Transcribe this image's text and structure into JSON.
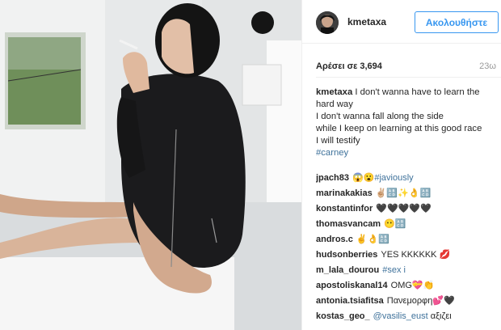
{
  "post": {
    "username": "kmetaxa",
    "follow_label": "Ακολουθήστε",
    "likes": "Αρέσει σε 3,694",
    "time": "23ω",
    "caption_lines": [
      "I don't wanna have to learn the hard way",
      "I don't wanna fall along the side",
      "while I keep on learning at this good race",
      "I will testify"
    ],
    "caption_tag": "#carney"
  },
  "comments": [
    {
      "user": "jpach83",
      "text": "😱😮",
      "tag": "#javiously"
    },
    {
      "user": "marinakakias",
      "text": "✌🏼🔠✨👌🔠",
      "tag": ""
    },
    {
      "user": "konstantinfor",
      "text": "🖤🖤🖤🖤🖤",
      "tag": ""
    },
    {
      "user": "thomasvancam",
      "text": "😶🔠",
      "tag": ""
    },
    {
      "user": "andros.c",
      "text": "✌👌🔠",
      "tag": ""
    },
    {
      "user": "hudsonberries",
      "text": "YES KKKKKK 💋",
      "tag": ""
    },
    {
      "user": "m_lala_dourou",
      "text": "",
      "tag": "#sex i"
    },
    {
      "user": "apostoliskanal14",
      "text": "OMG💝👏",
      "tag": ""
    },
    {
      "user": "antonia.tsiafitsa",
      "text": "Πανεμορφη💕🖤",
      "tag": ""
    },
    {
      "user": "kostas_geo_",
      "text": "αξιζει",
      "tag": "@vasilis_eust"
    }
  ],
  "colors": {
    "accent": "#3897f0",
    "link": "#3f729b",
    "muted": "#999999"
  },
  "icons": {
    "photo": "photo-image",
    "avatar": "avatar-image"
  }
}
